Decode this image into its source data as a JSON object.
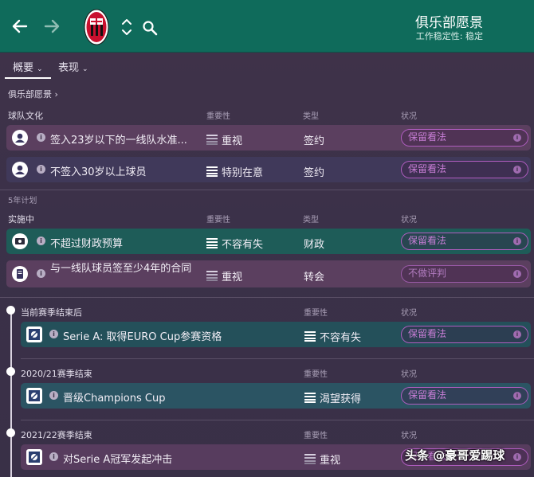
{
  "header": {
    "title": "俱乐部愿景",
    "subtitle": "工作稳定性: 稳定",
    "crest_text": "ACM 1899"
  },
  "tabs": [
    {
      "label": "概要",
      "active": true
    },
    {
      "label": "表现",
      "active": false
    }
  ],
  "breadcrumb": "俱乐部愿景",
  "columns": {
    "importance": "重要性",
    "type": "类型",
    "status": "状况"
  },
  "sections": {
    "culture": "球队文化",
    "five_year": "5年计划",
    "in_progress": "实施中"
  },
  "culture_rows": [
    {
      "text": "签入23岁以下的一线队水准...",
      "importance": "重视",
      "type": "签约",
      "status": "保留看法",
      "icon": "person-icon"
    },
    {
      "text": "不签入30岁以上球员",
      "importance": "特别在意",
      "type": "签约",
      "status": "保留看法",
      "icon": "person-icon"
    }
  ],
  "progress_rows": [
    {
      "text": "不超过财政预算",
      "importance": "不容有失",
      "type": "财政",
      "status": "保留看法",
      "icon": "money-icon"
    },
    {
      "text": "与一线队球员签至少4年的合同",
      "importance": "重视",
      "type": "转会",
      "status": "不做评判",
      "icon": "contract-icon"
    }
  ],
  "timeline": [
    {
      "label": "当前赛季结束后",
      "text": "Serie A: 取得EURO Cup参赛资格",
      "importance": "不容有失",
      "status": "保留看法"
    },
    {
      "label": "2020/21赛季结束",
      "text": "晋级Champions Cup",
      "importance": "渴望获得",
      "status": "保留看法"
    },
    {
      "label": "2021/22赛季结束",
      "text": "对Serie A冠军发起冲击",
      "importance": "重视",
      "status": "保留看法"
    }
  ],
  "watermark": "头条 @豪哥爱踢球",
  "colors": {
    "header": "#0f6b5b",
    "status_outline": "#b05dc0"
  }
}
